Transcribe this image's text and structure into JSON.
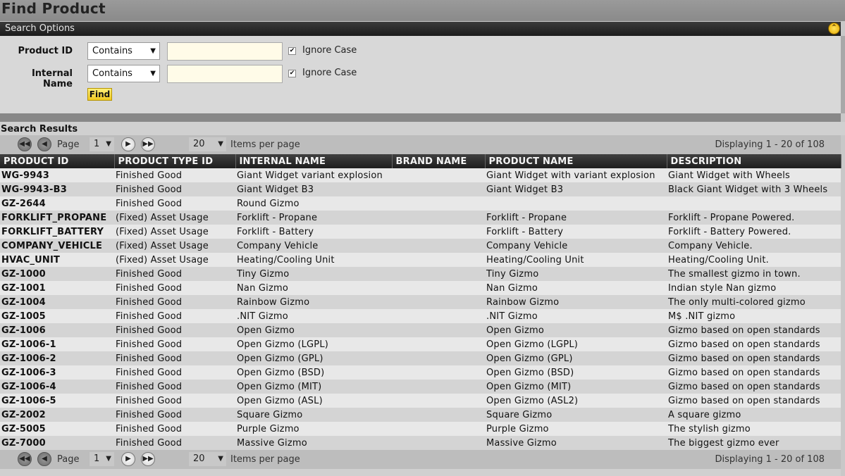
{
  "page_title": "Find Product",
  "search_options": {
    "header": "Search Options",
    "collapse_icon": "double-chevron-up-icon",
    "rows": [
      {
        "label": "Product ID",
        "operator": "Contains",
        "value": "",
        "ignore_case_checked": true,
        "ignore_case_label": "Ignore Case"
      },
      {
        "label": "Internal Name",
        "operator": "Contains",
        "value": "",
        "ignore_case_checked": true,
        "ignore_case_label": "Ignore Case"
      }
    ],
    "find_label": "Find"
  },
  "results": {
    "label": "Search Results",
    "pager": {
      "page_label": "Page",
      "page_value": "1",
      "per_page_value": "20",
      "per_page_label": "Items per page",
      "display_text": "Displaying 1 - 20 of 108"
    },
    "columns": [
      "PRODUCT ID",
      "PRODUCT TYPE ID",
      "INTERNAL NAME",
      "BRAND NAME",
      "PRODUCT NAME",
      "DESCRIPTION"
    ],
    "rows": [
      [
        "WG-9943",
        "Finished Good",
        "Giant Widget variant explosion",
        "",
        "Giant Widget with variant explosion",
        "Giant Widget with Wheels"
      ],
      [
        "WG-9943-B3",
        "Finished Good",
        "Giant Widget B3",
        "",
        "Giant Widget B3",
        "Black Giant Widget with 3 Wheels"
      ],
      [
        "GZ-2644",
        "Finished Good",
        "Round Gizmo",
        "",
        "",
        ""
      ],
      [
        "FORKLIFT_PROPANE",
        "(Fixed) Asset Usage",
        "Forklift - Propane",
        "",
        "Forklift - Propane",
        "Forklift - Propane Powered."
      ],
      [
        "FORKLIFT_BATTERY",
        "(Fixed) Asset Usage",
        "Forklift - Battery",
        "",
        "Forklift - Battery",
        "Forklift - Battery Powered."
      ],
      [
        "COMPANY_VEHICLE",
        "(Fixed) Asset Usage",
        "Company Vehicle",
        "",
        "Company Vehicle",
        "Company Vehicle."
      ],
      [
        "HVAC_UNIT",
        "(Fixed) Asset Usage",
        "Heating/Cooling Unit",
        "",
        "Heating/Cooling Unit",
        "Heating/Cooling Unit."
      ],
      [
        "GZ-1000",
        "Finished Good",
        "Tiny Gizmo",
        "",
        "Tiny Gizmo",
        "The smallest gizmo in town."
      ],
      [
        "GZ-1001",
        "Finished Good",
        "Nan Gizmo",
        "",
        "Nan Gizmo",
        "Indian style Nan gizmo"
      ],
      [
        "GZ-1004",
        "Finished Good",
        "Rainbow Gizmo",
        "",
        "Rainbow Gizmo",
        "The only multi-colored gizmo"
      ],
      [
        "GZ-1005",
        "Finished Good",
        ".NIT Gizmo",
        "",
        ".NIT Gizmo",
        "M$ .NIT gizmo"
      ],
      [
        "GZ-1006",
        "Finished Good",
        "Open Gizmo",
        "",
        "Open Gizmo",
        "Gizmo based on open standards"
      ],
      [
        "GZ-1006-1",
        "Finished Good",
        "Open Gizmo (LGPL)",
        "",
        "Open Gizmo (LGPL)",
        "Gizmo based on open standards"
      ],
      [
        "GZ-1006-2",
        "Finished Good",
        "Open Gizmo (GPL)",
        "",
        "Open Gizmo (GPL)",
        "Gizmo based on open standards"
      ],
      [
        "GZ-1006-3",
        "Finished Good",
        "Open Gizmo (BSD)",
        "",
        "Open Gizmo (BSD)",
        "Gizmo based on open standards"
      ],
      [
        "GZ-1006-4",
        "Finished Good",
        "Open Gizmo (MIT)",
        "",
        "Open Gizmo (MIT)",
        "Gizmo based on open standards"
      ],
      [
        "GZ-1006-5",
        "Finished Good",
        "Open Gizmo (ASL)",
        "",
        "Open Gizmo (ASL2)",
        "Gizmo based on open standards"
      ],
      [
        "GZ-2002",
        "Finished Good",
        "Square Gizmo",
        "",
        "Square Gizmo",
        "A square gizmo"
      ],
      [
        "GZ-5005",
        "Finished Good",
        "Purple Gizmo",
        "",
        "Purple Gizmo",
        "The stylish gizmo"
      ],
      [
        "GZ-7000",
        "Finished Good",
        "Massive Gizmo",
        "",
        "Massive Gizmo",
        "The biggest gizmo ever"
      ]
    ]
  }
}
